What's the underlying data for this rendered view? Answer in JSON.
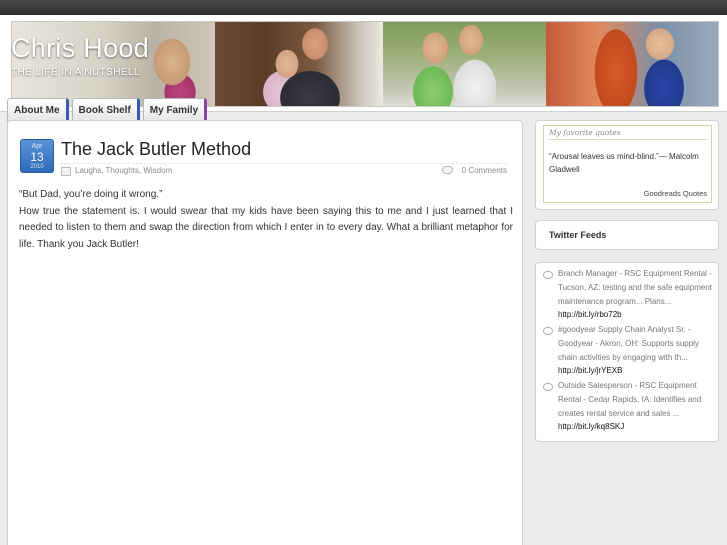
{
  "site": {
    "title": "Chris Hood",
    "tagline": "THE LIFE IN A NUTSHELL"
  },
  "nav": {
    "items": [
      {
        "label": "About Me"
      },
      {
        "label": "Book Shelf"
      },
      {
        "label": "My Family"
      }
    ]
  },
  "post": {
    "date": {
      "month": "Apr",
      "day": "13",
      "year": "2010"
    },
    "title": "The Jack Butler Method",
    "categories": "Laughs, Thoughts, Wisdom",
    "comments": "0 Comments",
    "body": [
      "“But Dad, you’re doing it wrong.”",
      "How true the statement is. I would swear that my kids have been saying this to me and I just learned that I needed to listen to them and swap the direction from which I enter in to every day. What a brilliant metaphor for life. Thank you Jack Butler!"
    ]
  },
  "sidebar": {
    "quotes": {
      "heading": "My favorite quotes",
      "text": "“Arousal leaves us mind-blind.”— Malcolm Gladwell",
      "source": "Goodreads Quotes"
    },
    "twitter": {
      "heading": "Twitter Feeds",
      "tweets": [
        {
          "text": "Branch Manager - RSC Equipment Rental - Tucson, AZ: testing and the safe equipment maintenance program... Plans... ",
          "link": "http://bit.ly/rbo72b"
        },
        {
          "text": "#goodyear Supply Chain Analyst Sr. - Goodyear - Akron, OH: Supports supply chain activities by engaging with th... ",
          "link": "http://bit.ly/jrYEXB"
        },
        {
          "text": "Outside Salesperson - RSC Equipment Rental - Cedar Rapids, IA: Identifies and creates rental service and sales ... ",
          "link": "http://bit.ly/kq8SKJ"
        }
      ]
    }
  },
  "colors": {
    "topbar": "#3a3a3a",
    "date_badge": "#2d6ab8",
    "nav_accent_blue": "#2f5fae",
    "nav_accent_purple": "#8e3fa8"
  },
  "icons": {
    "category": "folder-icon",
    "comments": "comment-bubble-icon",
    "tweet": "speech-bubble-icon"
  }
}
